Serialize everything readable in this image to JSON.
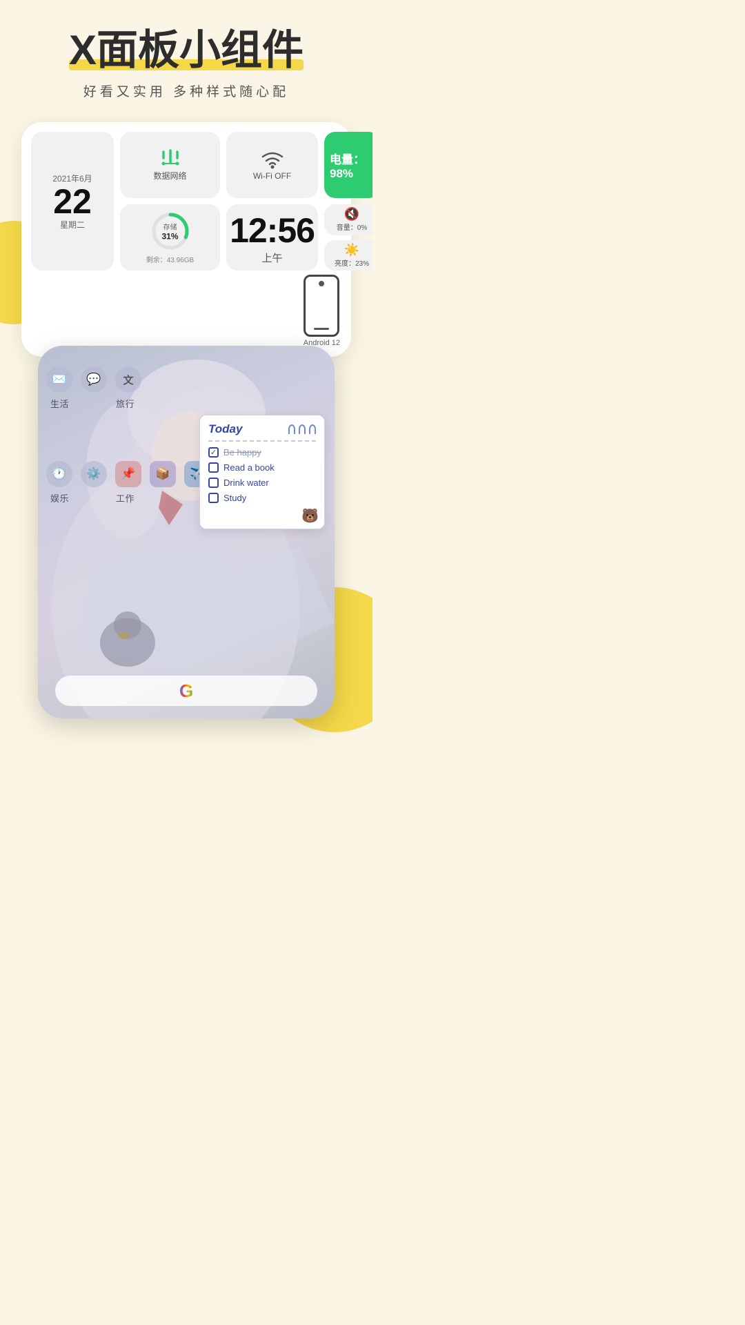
{
  "page": {
    "bg_color": "#faf6e8"
  },
  "header": {
    "title": "X面板小组件",
    "subtitle": "好看又实用  多种样式随心配"
  },
  "widget": {
    "date": {
      "year_month": "2021年6月",
      "day": "22",
      "weekday": "星期二"
    },
    "data_network": {
      "label": "数据网络"
    },
    "wifi": {
      "label": "Wi-Fi OFF"
    },
    "battery": {
      "label": "电量：98%"
    },
    "sound": {
      "label": "音量：0%"
    },
    "brightness": {
      "label": "亮度：23%"
    },
    "android_label": "Android 12",
    "storage": {
      "percent": "31%",
      "label": "存储",
      "remaining": "剩余：43.96GB"
    },
    "clock": {
      "time": "12:56",
      "ampm": "上午"
    }
  },
  "phone_screen": {
    "folder1": {
      "label": "生活"
    },
    "folder2": {
      "label": "旅行"
    },
    "folder3": {
      "label": "娱乐"
    },
    "folder4": {
      "label": "工作"
    },
    "google_icon": "G"
  },
  "notepad": {
    "title": "Today",
    "items": [
      {
        "text": "Be happy",
        "checked": true,
        "strikethrough": true
      },
      {
        "text": "Read a book",
        "checked": false,
        "strikethrough": false
      },
      {
        "text": "Drink water",
        "checked": false,
        "strikethrough": false
      },
      {
        "text": "Study",
        "checked": false,
        "strikethrough": false
      }
    ]
  }
}
